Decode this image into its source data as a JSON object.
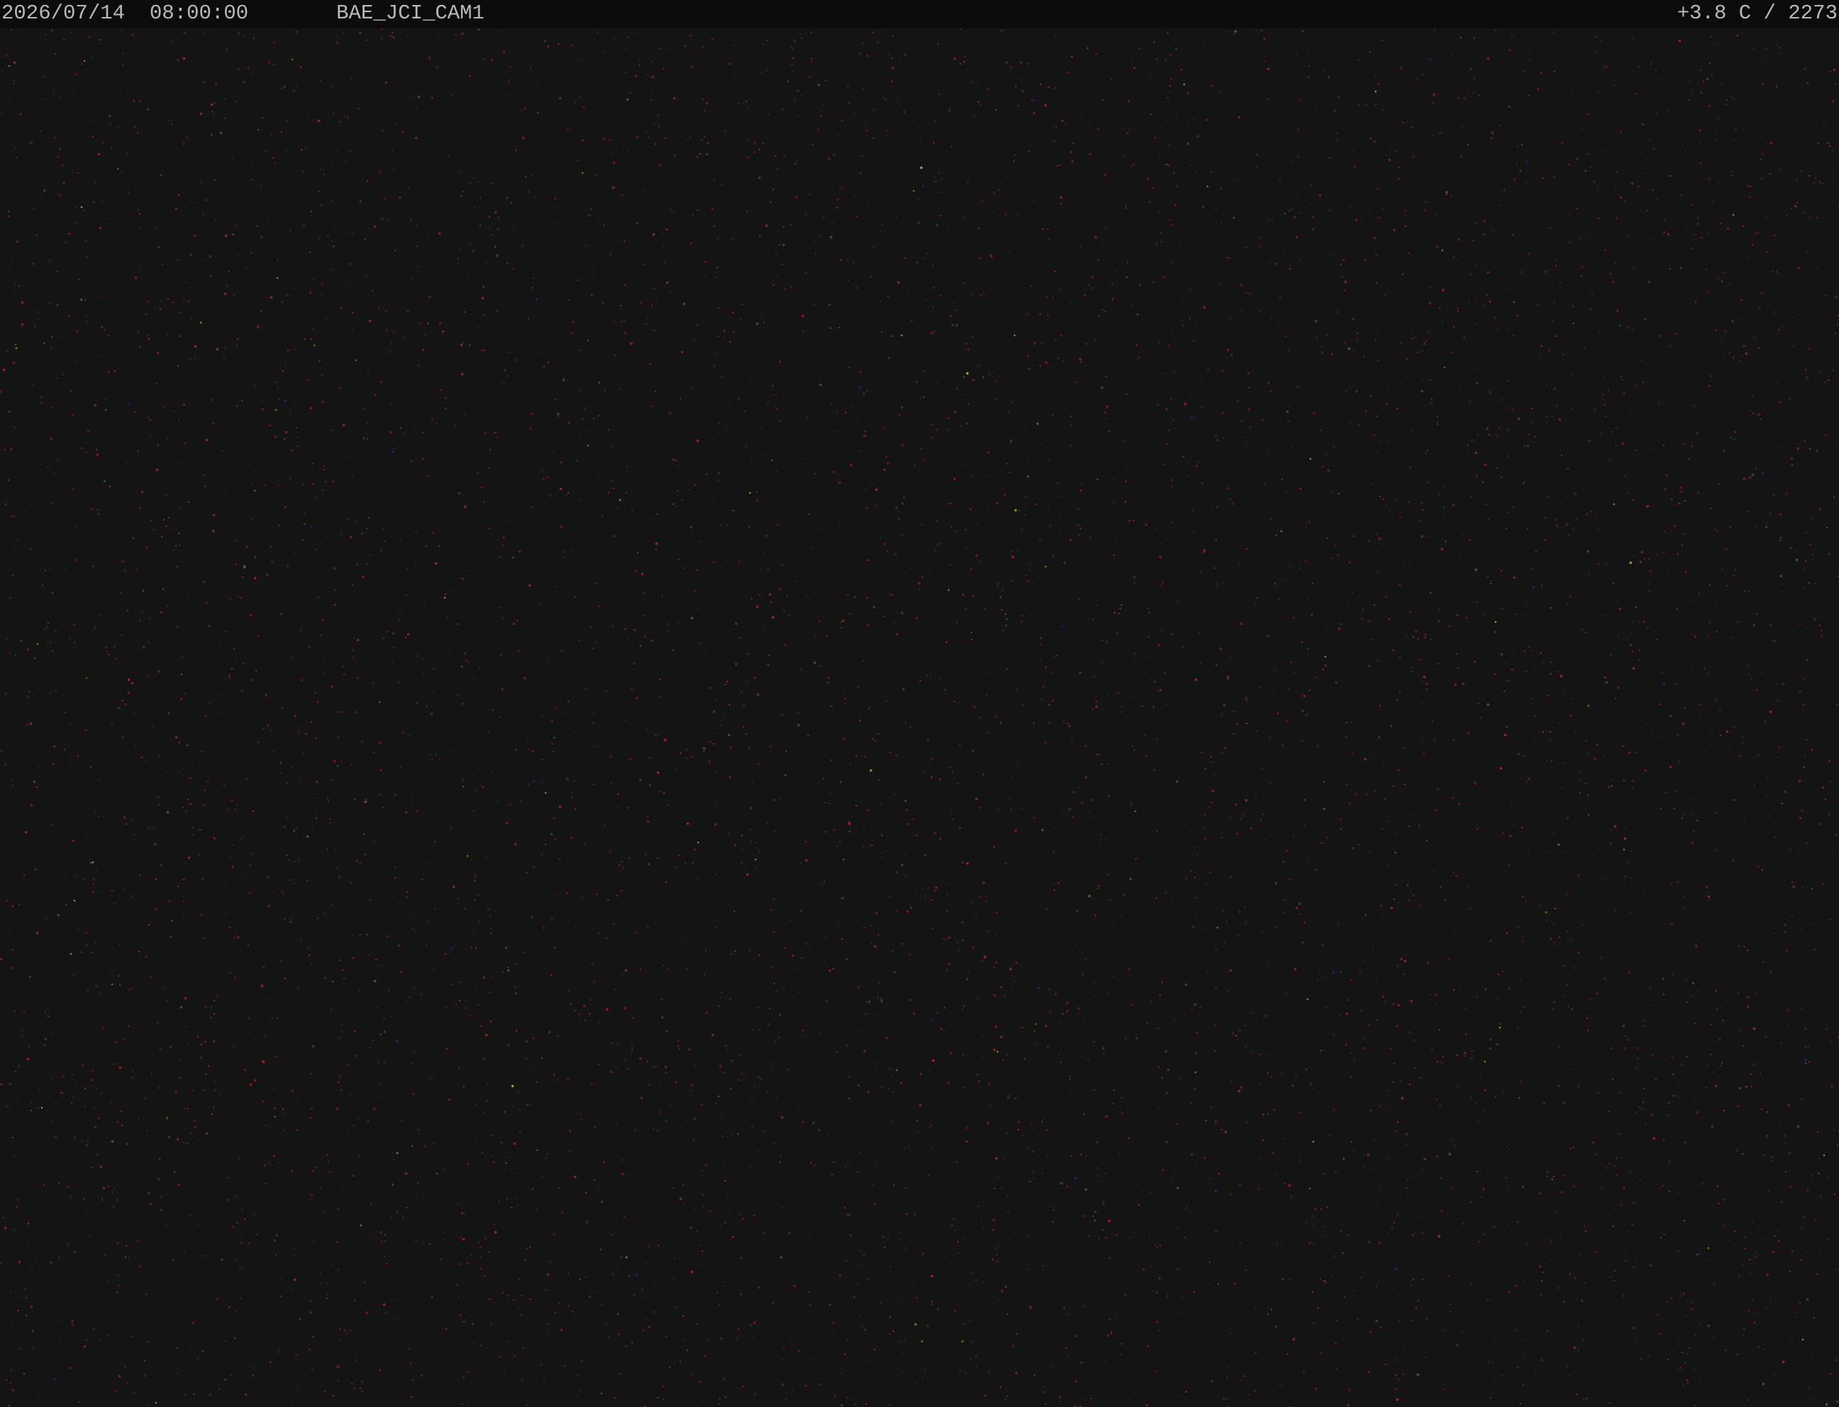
{
  "overlay": {
    "timestamp": "2026/07/14  08:00:00",
    "camera_id": "BAE_JCI_CAM1",
    "telemetry": "+3.8 C / 2273"
  },
  "image": {
    "description_tone": "dark",
    "background_color": "#141414",
    "noise_colors": [
      "#b0283a",
      "#8a2030",
      "#3a4a2a",
      "#2a2a6a",
      "#5a5a5a",
      "#c0c040"
    ]
  }
}
